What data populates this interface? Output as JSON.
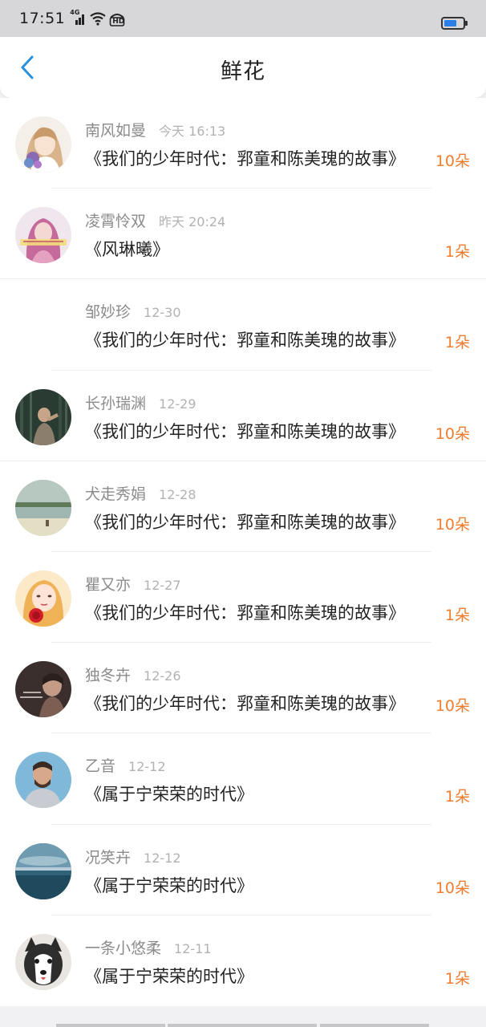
{
  "status_bar": {
    "time": "17:51",
    "network": "4G",
    "hd": "HD"
  },
  "header": {
    "title": "鲜花"
  },
  "items": [
    {
      "name": "南风如曼",
      "time": "今天 16:13",
      "book": "《我们的少年时代：郛童和陈美瑰的故事》",
      "count": "10朵",
      "avatar": "anime-girl-avatar"
    },
    {
      "name": "凌霄怜双",
      "time": "昨天 20:24",
      "book": "《风琳曦》",
      "count": "1朵",
      "avatar": "pink-hair-girl-avatar"
    },
    {
      "name": "邹妙珍",
      "time": "12-30",
      "book": "《我们的少年时代：郛童和陈美瑰的故事》",
      "count": "1朵",
      "avatar": "blank-avatar"
    },
    {
      "name": "长孙瑞渊",
      "time": "12-29",
      "book": "《我们的少年时代：郛童和陈美瑰的故事》",
      "count": "10朵",
      "avatar": "forest-man-avatar"
    },
    {
      "name": "犬走秀娟",
      "time": "12-28",
      "book": "《我们的少年时代：郛童和陈美瑰的故事》",
      "count": "10朵",
      "avatar": "lake-landscape-avatar"
    },
    {
      "name": "瞿又亦",
      "time": "12-27",
      "book": "《我们的少年时代：郛童和陈美瑰的故事》",
      "count": "1朵",
      "avatar": "girl-with-rose-avatar"
    },
    {
      "name": "独冬卉",
      "time": "12-26",
      "book": "《我们的少年时代：郛童和陈美瑰的故事》",
      "count": "10朵",
      "avatar": "dark-photo-avatar"
    },
    {
      "name": "乙音",
      "time": "12-12",
      "book": "《属于宁荣荣的时代》",
      "count": "1朵",
      "avatar": "bearded-man-avatar"
    },
    {
      "name": "况笑卉",
      "time": "12-12",
      "book": "《属于宁荣荣的时代》",
      "count": "10朵",
      "avatar": "ocean-avatar"
    },
    {
      "name": "一条小悠柔",
      "time": "12-11",
      "book": "《属于宁荣荣的时代》",
      "count": "1朵",
      "avatar": "husky-dog-avatar"
    }
  ],
  "colors": {
    "accent_blue": "#2b8fe0",
    "count_orange": "#ef7d2d"
  }
}
